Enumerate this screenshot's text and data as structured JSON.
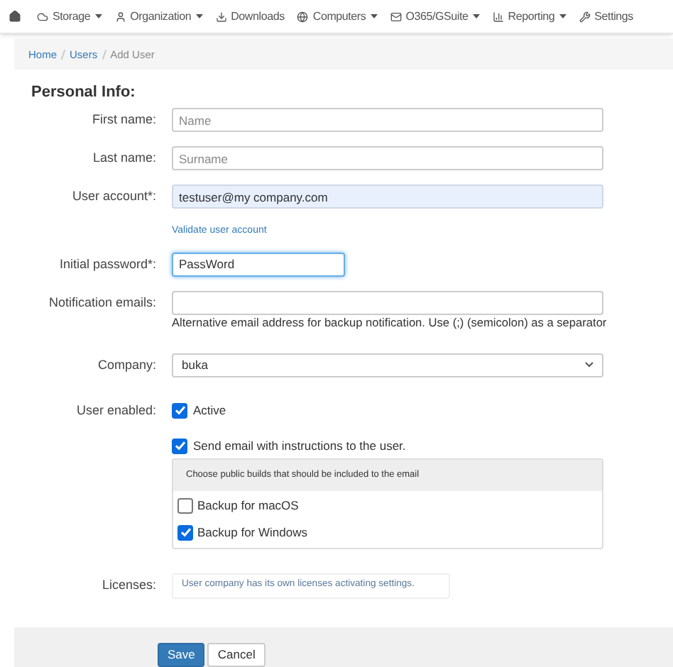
{
  "nav": {
    "items": [
      {
        "label": "Storage",
        "dropdown": true
      },
      {
        "label": "Organization",
        "dropdown": true
      },
      {
        "label": "Downloads",
        "dropdown": false
      },
      {
        "label": "Computers",
        "dropdown": true
      },
      {
        "label": "O365/GSuite",
        "dropdown": true
      },
      {
        "label": "Reporting",
        "dropdown": true
      },
      {
        "label": "Settings",
        "dropdown": false
      }
    ]
  },
  "breadcrumb": [
    {
      "label": "Home",
      "current": false
    },
    {
      "label": "Users",
      "current": false
    },
    {
      "label": "Add User",
      "current": true
    }
  ],
  "section_title": "Personal Info:",
  "fields": [
    {
      "kind": "text",
      "label": "First name:",
      "placeholder": "Name"
    },
    {
      "kind": "text",
      "label": "Last name:",
      "placeholder": "Surname"
    },
    {
      "kind": "text",
      "label": "User account*:",
      "value": "testuser@my company.com",
      "autofilled": true,
      "link": "Validate user account"
    },
    {
      "kind": "password",
      "label": "Initial password*:",
      "value": "PassWord",
      "focused": true
    },
    {
      "kind": "text",
      "label": "Notification emails:",
      "help": "Alternative email address for backup notification. Use (;) (semicolon) as a separator"
    },
    {
      "kind": "select",
      "label": "Company:",
      "value": "buka"
    },
    {
      "kind": "checkbox",
      "label": "User enabled:",
      "option": "Active",
      "checked": true
    }
  ],
  "send_email": {
    "label": "Send email with instructions to the user.",
    "checked": true,
    "panel_title": "Choose public builds that should be included to the email",
    "builds": [
      {
        "label": "Backup for macOS",
        "checked": false
      },
      {
        "label": "Backup for Windows",
        "checked": true
      }
    ]
  },
  "licenses": {
    "label": "Licenses:",
    "note": "User company has its own licenses activating settings."
  },
  "buttons": [
    {
      "label": "Save",
      "primary": true
    },
    {
      "label": "Cancel",
      "primary": false
    }
  ]
}
